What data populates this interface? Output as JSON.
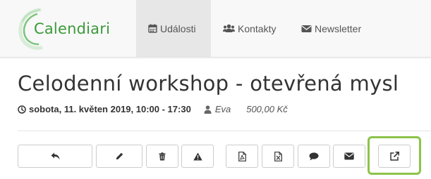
{
  "brand": {
    "name": "Calendiari",
    "color": "#3a9a3a"
  },
  "nav": {
    "items": [
      {
        "label": "Události",
        "icon": "calendar-icon",
        "active": true
      },
      {
        "label": "Kontakty",
        "icon": "users-icon",
        "active": false
      },
      {
        "label": "Newsletter",
        "icon": "envelope-icon",
        "active": false
      }
    ]
  },
  "event": {
    "title": "Celodenní workshop - otevřená mysl",
    "date": "sobota, 11. květen 2019, 10:00 - 17:30",
    "author": "Eva",
    "price": "500,00 Kč"
  },
  "toolbar": {
    "buttons": [
      {
        "name": "back-button",
        "icon": "reply-icon"
      },
      {
        "name": "edit-button",
        "icon": "pencil-icon"
      },
      {
        "name": "delete-button",
        "icon": "trash-icon"
      },
      {
        "name": "warning-button",
        "icon": "warning-icon"
      },
      {
        "name": "export-pdf-button",
        "icon": "pdf-file-icon"
      },
      {
        "name": "export-excel-button",
        "icon": "excel-file-icon"
      },
      {
        "name": "comment-button",
        "icon": "comment-icon"
      },
      {
        "name": "email-button",
        "icon": "envelope-icon"
      },
      {
        "name": "open-external-button",
        "icon": "external-link-icon"
      }
    ],
    "highlight_color": "#8bc34a"
  }
}
